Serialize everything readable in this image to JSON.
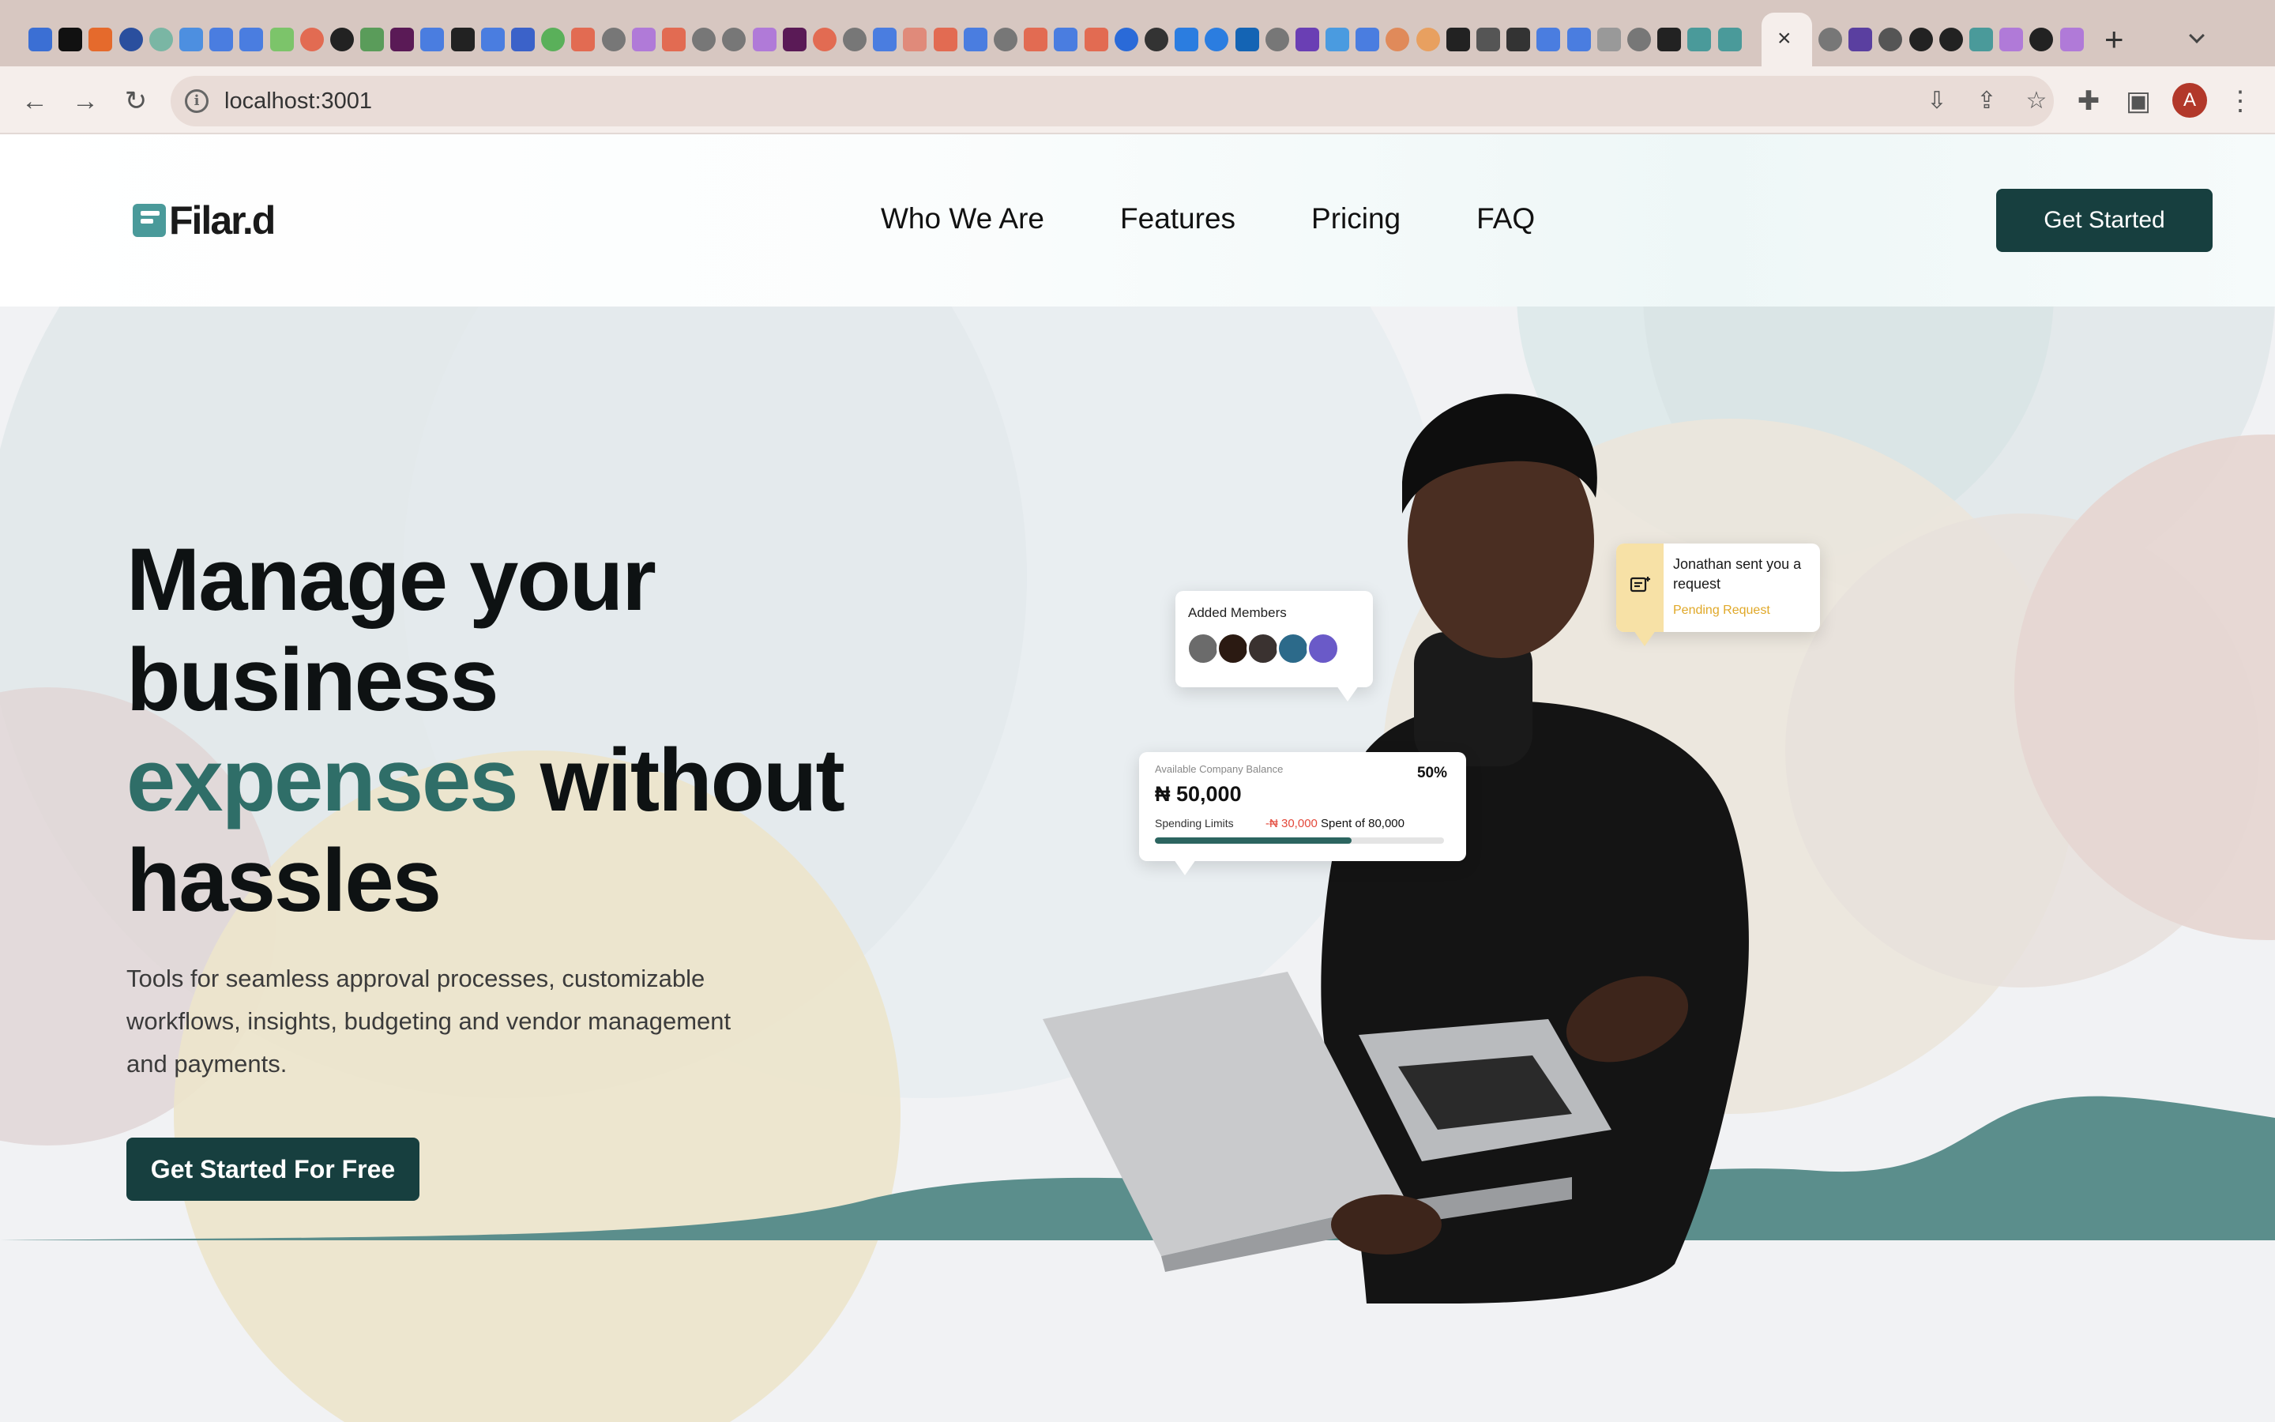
{
  "browser": {
    "url": "localhost:3001",
    "active_tab_close": "×",
    "new_tab": "+",
    "avatar_letter": "A"
  },
  "site": {
    "brand": "Filar.d",
    "nav": [
      "Who We Are",
      "Features",
      "Pricing",
      "FAQ"
    ],
    "header_cta": "Get Started"
  },
  "hero": {
    "title_line1": "Manage your",
    "title_line2": "business",
    "title_accent": "expenses",
    "title_rest": "without",
    "title_line4": "hassles",
    "subtitle": "Tools for seamless approval processes, customizable workflows, insights, budgeting and vendor management and payments.",
    "cta": "Get Started For Free"
  },
  "cards": {
    "members": {
      "label": "Added Members"
    },
    "request": {
      "message": "Jonathan sent you a request",
      "status": "Pending Request"
    },
    "balance": {
      "label": "Available Company Balance",
      "amount": "₦ 50,000",
      "percent_label": "50%",
      "limits_label": "Spending Limits",
      "spent": "-₦ 30,000",
      "spent_of": "Spent of",
      "total": "80,000",
      "progress": 0.68
    }
  },
  "colors": {
    "brand_dark": "#173f3f",
    "accent_teal": "#2f6e68",
    "wave": "#5b8e8c",
    "pending": "#e0a828"
  }
}
